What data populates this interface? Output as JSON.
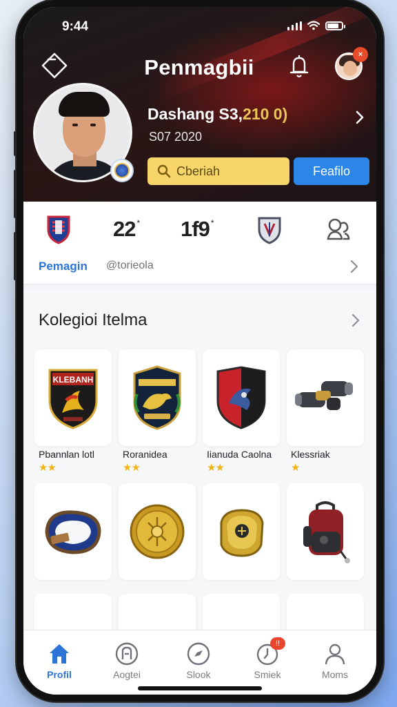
{
  "status_bar": {
    "time": "9:44"
  },
  "header": {
    "title": "Penmagbii",
    "notification_badge": "×",
    "stats_line_main": "Dashang S3,",
    "stats_line_accent": "210 0)",
    "date": "S07 2020",
    "search_label": "Cberiah",
    "portfolio_label": "Feafilo"
  },
  "stats": {
    "value_1": "22",
    "value_1_suffix": "*",
    "value_2": "1f9",
    "value_2_suffix": "*",
    "profile_name": "Pemagin",
    "handle": "@torieola"
  },
  "collection": {
    "title": "Kolegioi Itelma",
    "items": [
      {
        "label": "Pbannlan lotl",
        "stars": "★★",
        "art": "badge-shield-icon"
      },
      {
        "label": "Roranidea",
        "stars": "★★",
        "art": "crest-horse-icon"
      },
      {
        "label": "Iianuda Caolna",
        "stars": "★★",
        "art": "shield-red-icon"
      },
      {
        "label": "Klessriak",
        "stars": "★",
        "art": "binoculars-icon"
      },
      {
        "label": "",
        "stars": "",
        "art": "wristband-icon"
      },
      {
        "label": "",
        "stars": "",
        "art": "gold-coin-icon"
      },
      {
        "label": "",
        "stars": "",
        "art": "gold-ring-icon"
      },
      {
        "label": "",
        "stars": "",
        "art": "backpack-icon"
      }
    ]
  },
  "bottom_nav": [
    {
      "label": "Profil",
      "icon": "home-icon",
      "active": true
    },
    {
      "label": "Aogtei",
      "icon": "profile-circle-icon",
      "active": false
    },
    {
      "label": "Slook",
      "icon": "compass-icon",
      "active": false
    },
    {
      "label": "Smiek",
      "icon": "clock-icon",
      "active": false,
      "badge": "!!"
    },
    {
      "label": "Moms",
      "icon": "user-icon",
      "active": false
    }
  ],
  "colors": {
    "accent_blue": "#2c86e8",
    "search_yellow": "#f7d56a",
    "header_dark": "#1b1b1d",
    "header_red": "#8f1a1a",
    "badge_red": "#e84b2a",
    "star_gold": "#f0b418"
  }
}
